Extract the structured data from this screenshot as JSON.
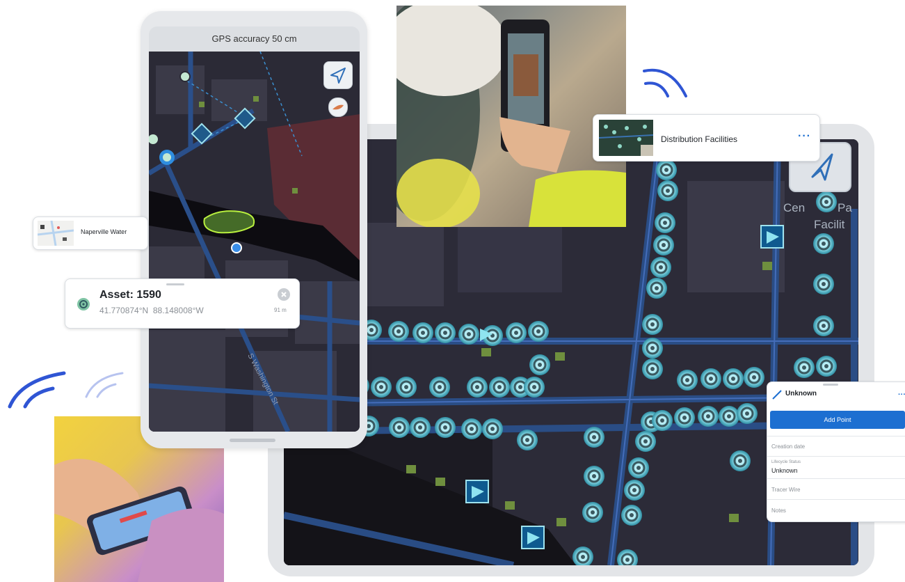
{
  "phone": {
    "gps_status": "GPS accuracy 50 cm",
    "street_label": "S Washington St",
    "locate_icon": "navigation-arrow-icon",
    "basemap_icon": "basemap-layers-icon"
  },
  "asset_card": {
    "title": "Asset: 1590",
    "coordinates": "41.770874°N  88.148008°W",
    "distance": "91 m",
    "close_icon": "close-icon",
    "asset_icon": "manhole-asset-icon"
  },
  "naperville_card": {
    "label": "Naperville Water"
  },
  "distribution_card": {
    "label": "Distribution Facilities",
    "more_icon": "more-options-icon"
  },
  "tablet_map": {
    "label_line1": "Cen",
    "label_line1b": "Pa",
    "label_line2": "Facilit"
  },
  "form_panel": {
    "title": "Unknown",
    "more_icon": "more-options-icon",
    "add_button": "Add Point",
    "fields": [
      {
        "label": "Creation date",
        "value": ""
      },
      {
        "label": "Lifecycle Status",
        "value": "Unknown"
      },
      {
        "label": "Tracer Wire",
        "value": ""
      },
      {
        "label": "Notes",
        "value": ""
      }
    ]
  },
  "colors": {
    "accent_blue": "#1d6fd1",
    "wifi_blue": "#2f55d4",
    "map_dark": "#2c2b38",
    "pipe_blue": "#2a4f8a",
    "node_cyan": "#7fd8e6",
    "polygon_green": "#5f8a3a"
  }
}
